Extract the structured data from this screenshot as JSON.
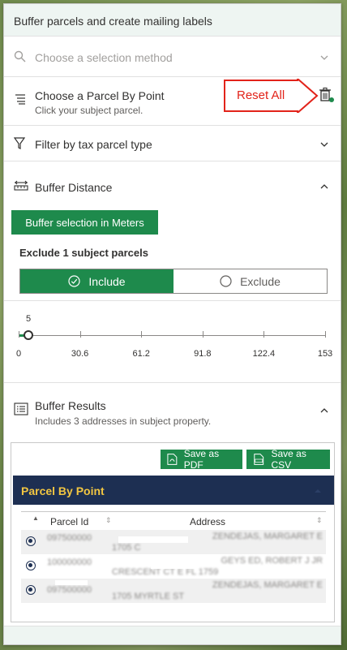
{
  "panel": {
    "title": "Buffer parcels and create mailing labels"
  },
  "selection_method": {
    "title": "Choose a selection method"
  },
  "parcel_by_point": {
    "title": "Choose a Parcel By Point",
    "subtitle": "Click your subject parcel.",
    "callout": "Reset All"
  },
  "filter": {
    "title": "Filter by tax parcel type"
  },
  "buffer_distance": {
    "title": "Buffer Distance",
    "units_button": "Buffer selection in Meters",
    "exclude_title": "Exclude 1 subject parcels",
    "include_label": "Include",
    "exclude_label": "Exclude",
    "slider_value": "5",
    "slider": {
      "min": 0,
      "max": 153,
      "value": 5
    },
    "ticks": [
      "0",
      "30.6",
      "61.2",
      "91.8",
      "122.4",
      "153"
    ]
  },
  "results": {
    "title": "Buffer Results",
    "subtitle": "Includes 3 addresses in subject property.",
    "save_pdf": "Save as PDF",
    "save_csv": "Save as CSV",
    "group_title": "Parcel By Point",
    "columns": [
      "Parcel Id",
      "Address"
    ],
    "rows": [
      {
        "parcel": "097500000",
        "address_1": "ZENDEJAS, MARGARET E",
        "address_2": "1705 C"
      },
      {
        "parcel": "100000000",
        "address_1": "GEYS ED, ROBERT J JR",
        "address_2": "CRESCENT CT E FL 1759"
      },
      {
        "parcel": "097500000",
        "address_1": "ZENDEJAS, MARGARET E",
        "address_2": "1705 MYRTLE ST"
      }
    ]
  },
  "colors": {
    "accent": "#1e8a4c",
    "navy": "#1d2f52",
    "gold": "#f2c641",
    "callout": "#e2231a"
  }
}
